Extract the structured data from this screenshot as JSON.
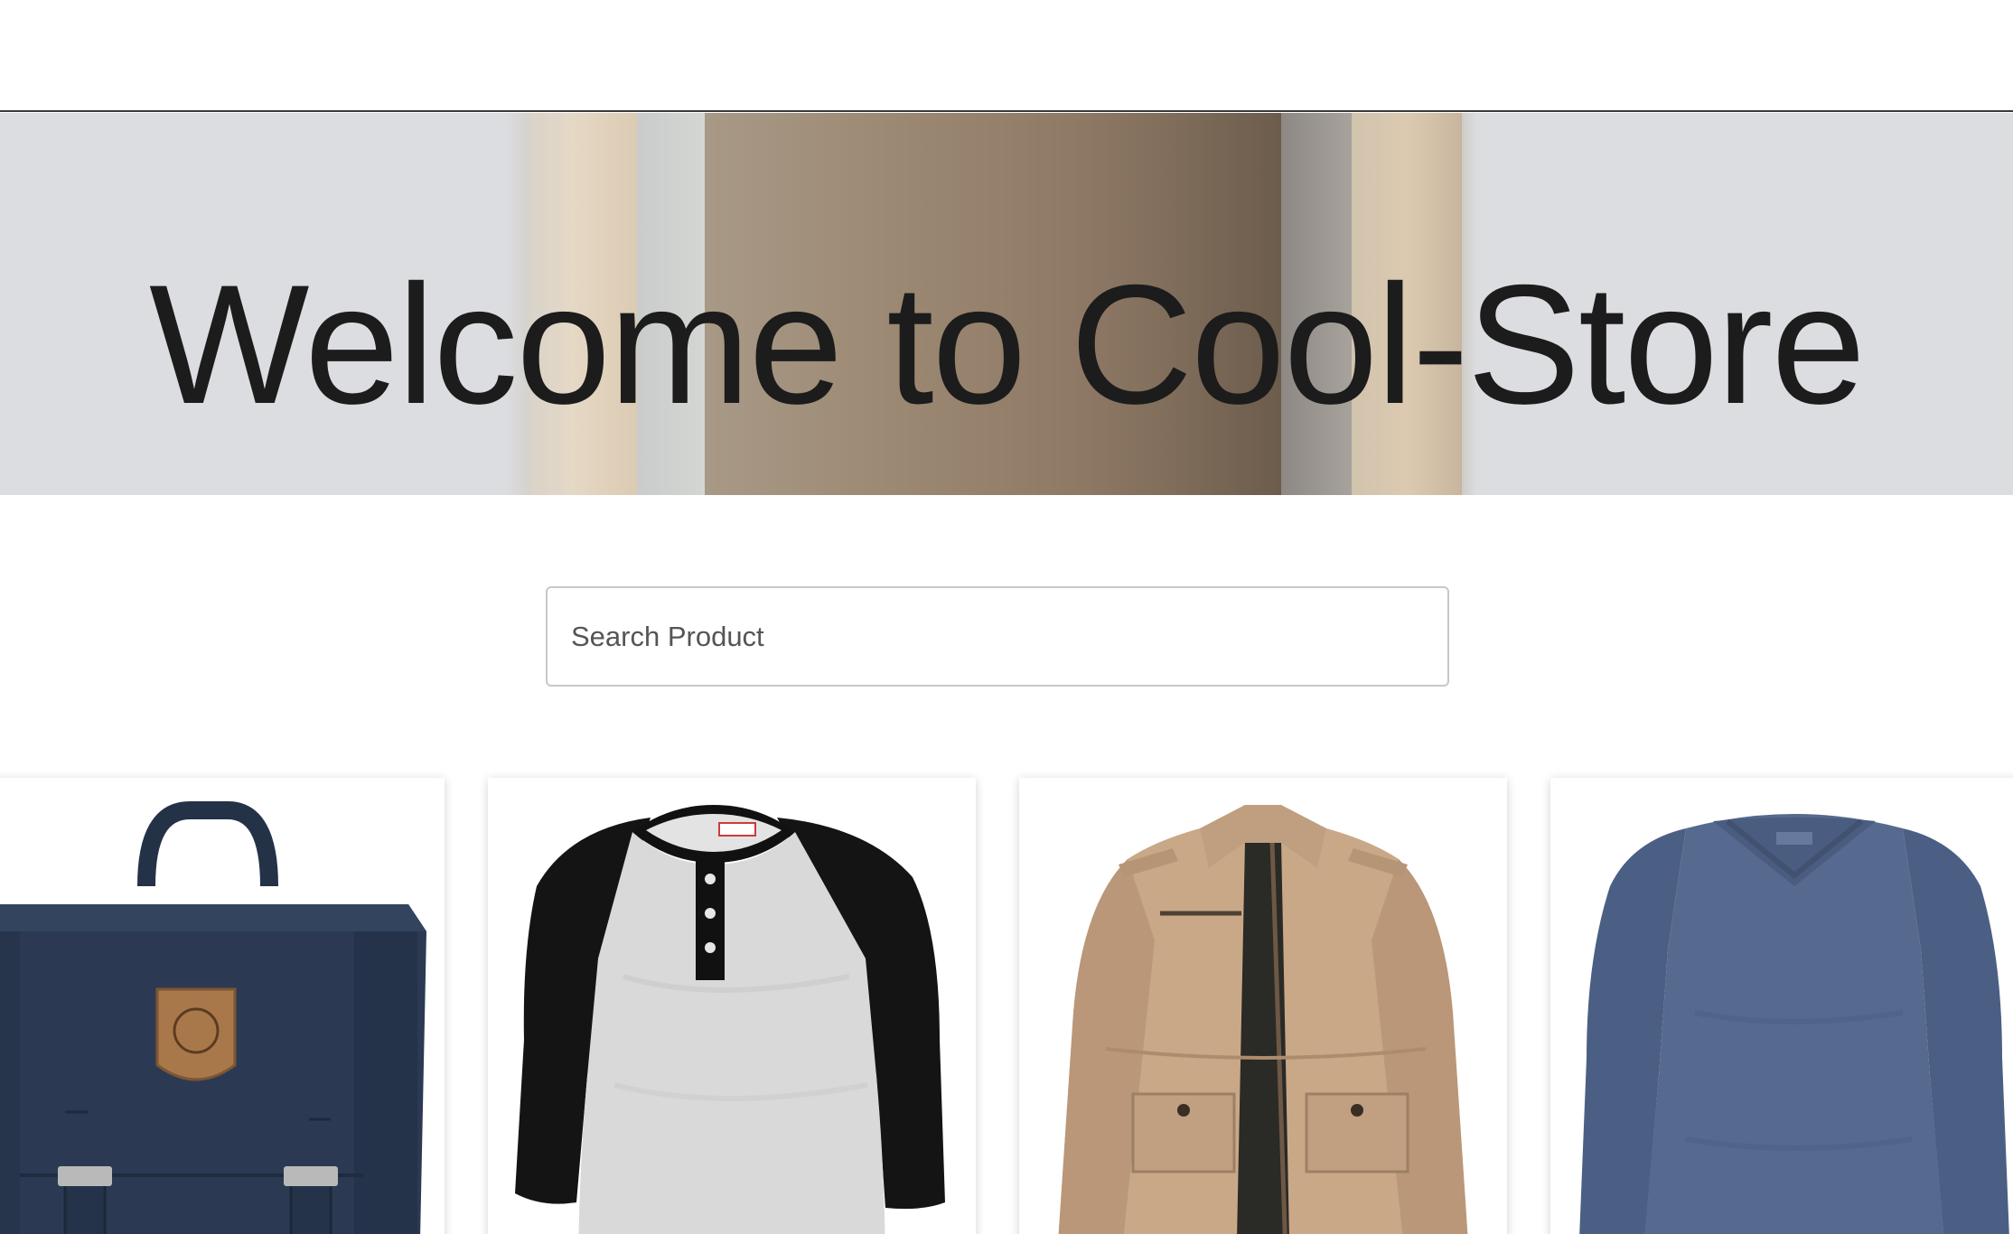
{
  "hero": {
    "title": "Welcome to Cool-Store"
  },
  "search": {
    "placeholder": "Search Product"
  },
  "products": [
    {
      "image": "navy-backpack"
    },
    {
      "image": "raglan-henley-shirt"
    },
    {
      "image": "khaki-jacket"
    },
    {
      "image": "blue-v-neck-long-sleeve"
    }
  ],
  "colors": {
    "background": "#ffffff",
    "hero_background": "#dcdde0",
    "title_text": "#1c1c1c",
    "backpack": "#2b3a52",
    "jacket": "#c9a888",
    "vneck": "#54698f"
  }
}
